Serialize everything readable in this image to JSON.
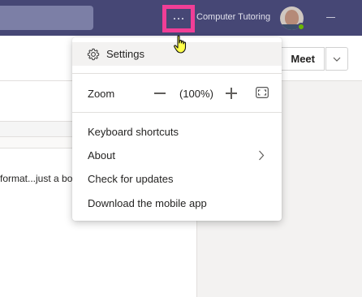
{
  "titlebar": {
    "org_name": "Computer Tutoring",
    "more_options_icon": "ellipsis-icon",
    "highlight_color": "#f03e96",
    "background_color": "#464775"
  },
  "meet": {
    "label": "Meet"
  },
  "message": {
    "preview": "format...just a bo"
  },
  "menu": {
    "settings_label": "Settings",
    "zoom_label": "Zoom",
    "zoom_value": "(100%)",
    "keyboard_shortcuts_label": "Keyboard shortcuts",
    "about_label": "About",
    "check_updates_label": "Check for updates",
    "download_app_label": "Download the mobile app"
  }
}
